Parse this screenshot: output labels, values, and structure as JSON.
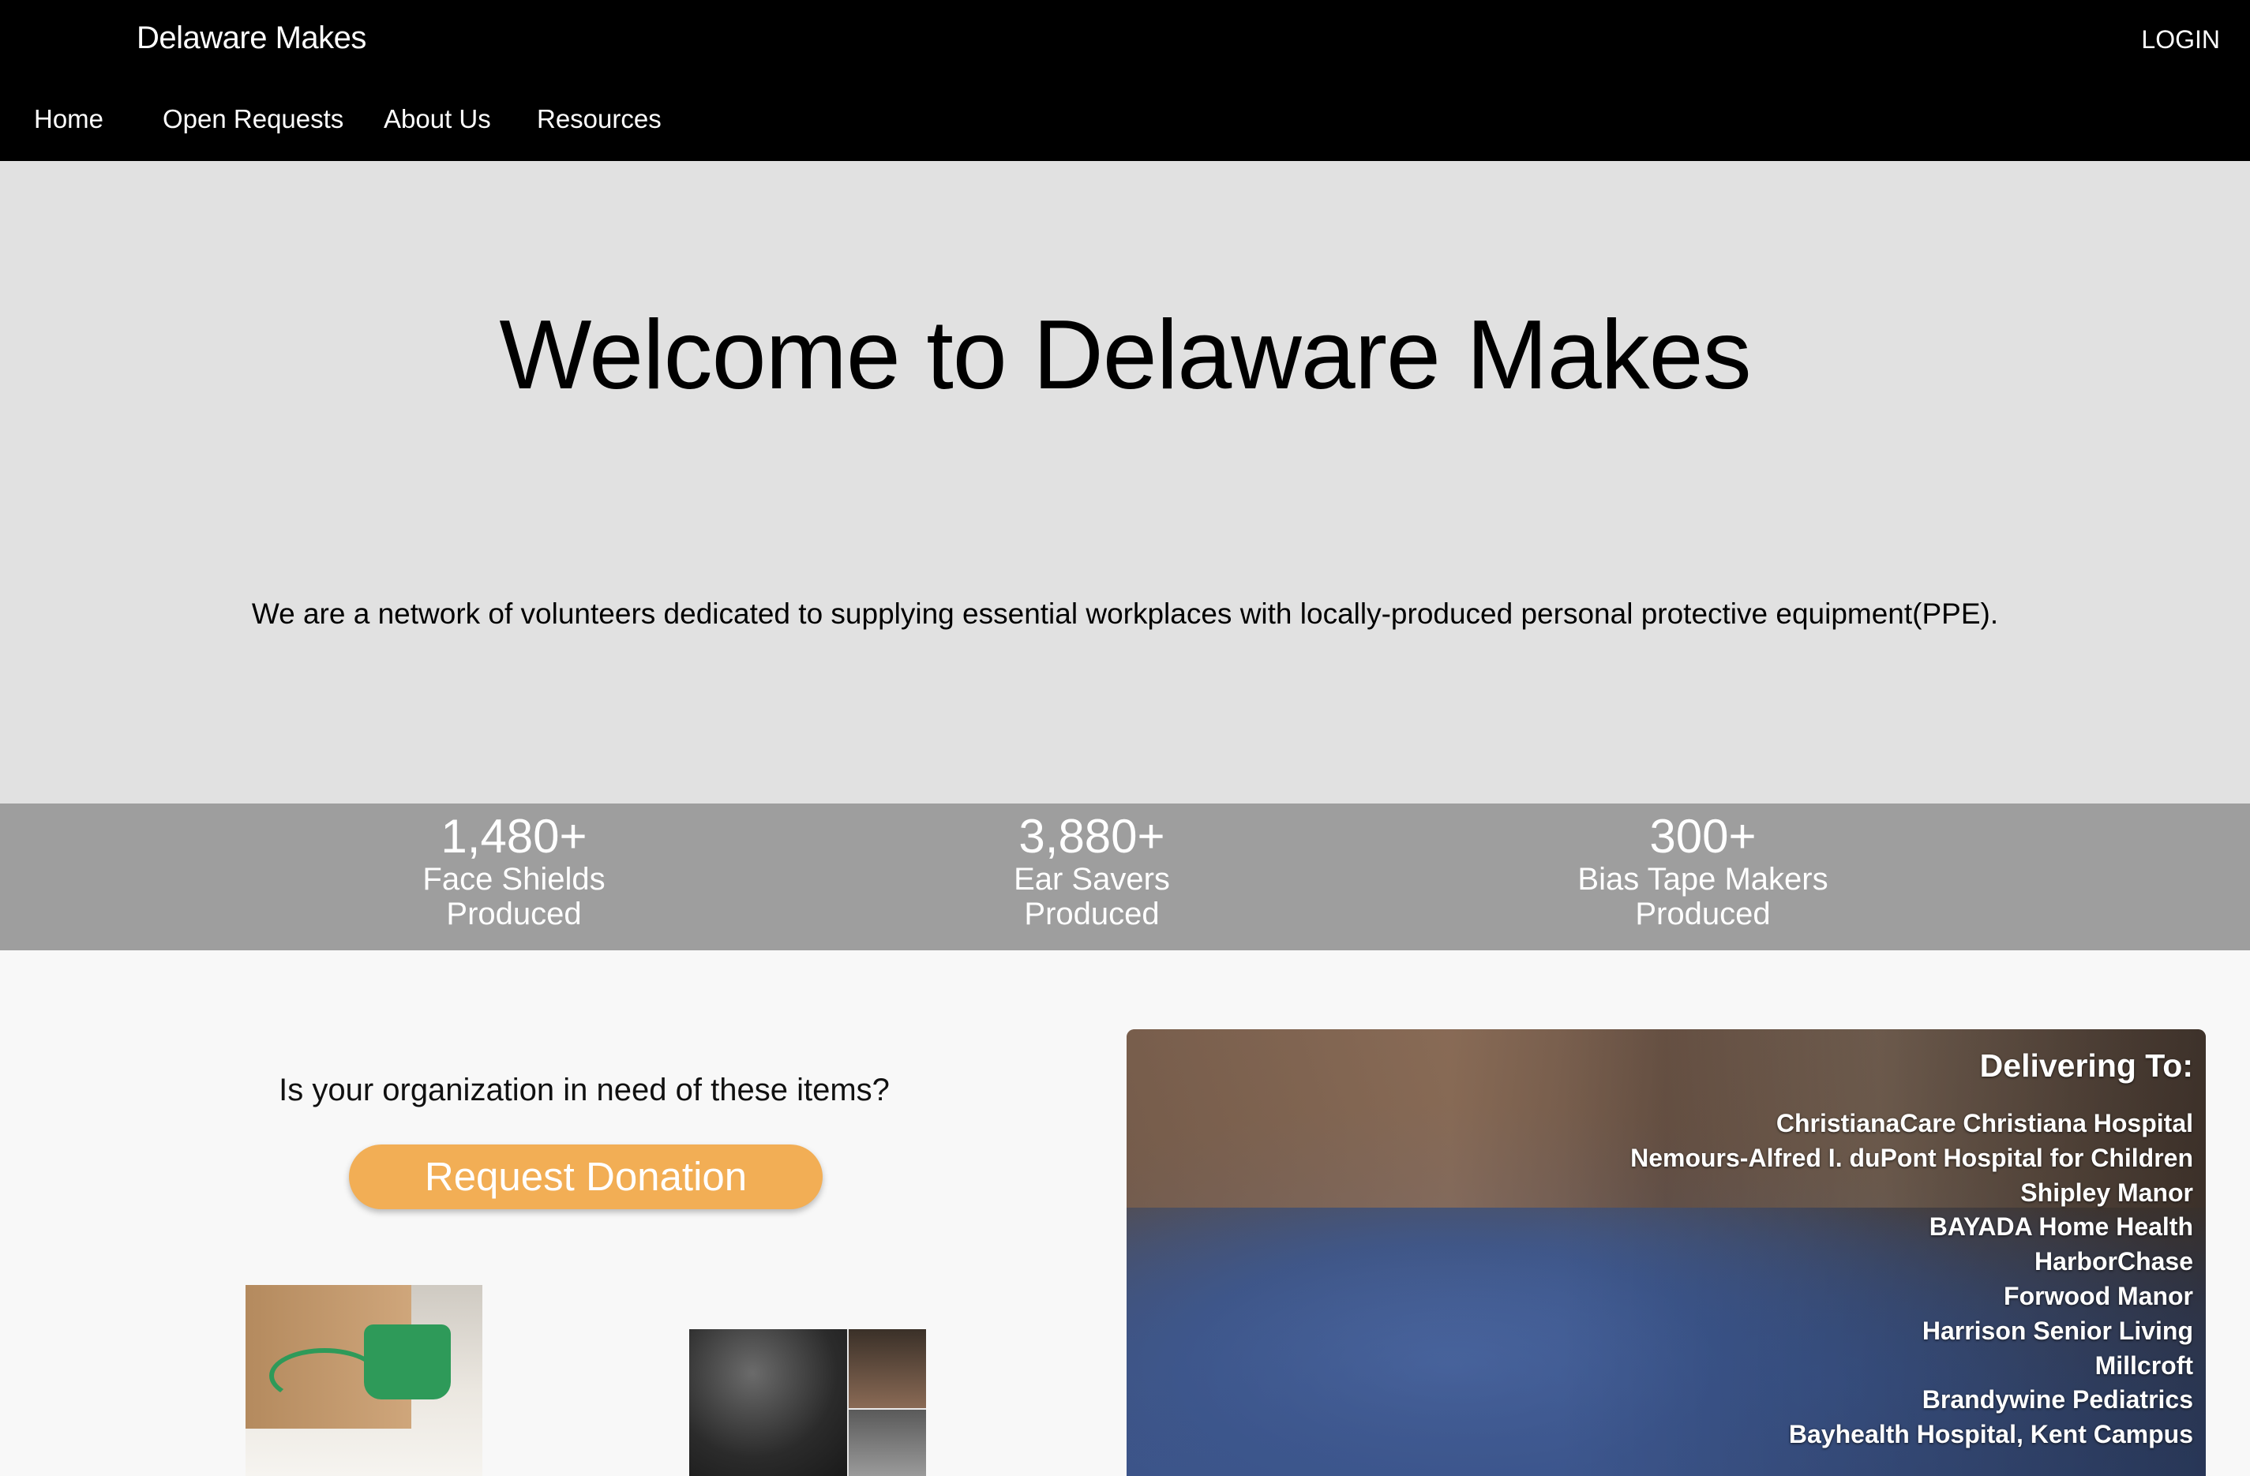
{
  "header": {
    "brand": "Delaware Makes",
    "login": "LOGIN",
    "nav": [
      "Home",
      "Open Requests",
      "About Us",
      "Resources"
    ]
  },
  "hero": {
    "title": "Welcome to Delaware Makes",
    "subtitle": "We are a network of volunteers dedicated to supplying essential workplaces with locally-produced personal protective equipment(PPE)."
  },
  "stats": [
    {
      "number": "1,480+",
      "label1": "Face Shields",
      "label2": "Produced"
    },
    {
      "number": "3,880+",
      "label1": "Ear Savers",
      "label2": "Produced"
    },
    {
      "number": "300+",
      "label1": "Bias Tape Makers",
      "label2": "Produced"
    }
  ],
  "request": {
    "question": "Is your organization in need of these items?",
    "button": "Request Donation"
  },
  "delivering": {
    "title": "Delivering To:",
    "places": [
      "ChristianaCare Christiana Hospital",
      "Nemours-Alfred I. duPont Hospital for Children",
      "Shipley Manor",
      "BAYADA Home Health",
      "HarborChase",
      "Forwood Manor",
      "Harrison Senior Living",
      "Millcroft",
      "Brandywine Pediatrics",
      "Bayhealth Hospital, Kent Campus"
    ]
  },
  "colors": {
    "header_bg": "#000000",
    "hero_bg": "#e1e1e1",
    "stats_bg": "#9e9e9e",
    "button_bg": "#f2ae55"
  }
}
